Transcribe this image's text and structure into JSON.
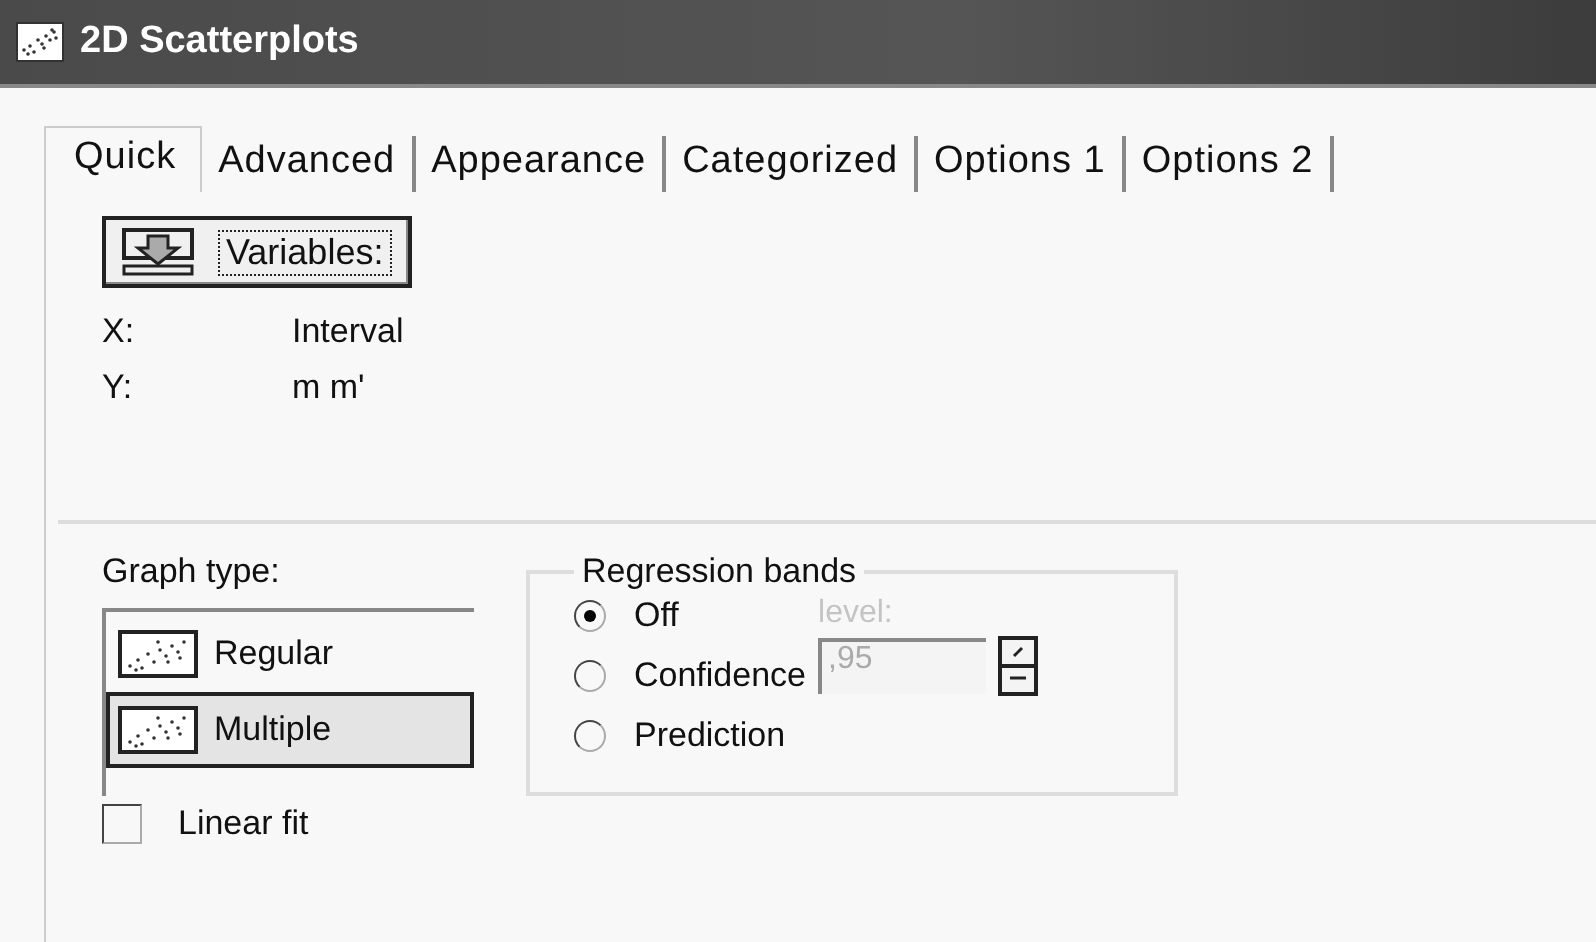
{
  "window": {
    "title": "2D Scatterplots"
  },
  "tabs": [
    {
      "label": "Quick",
      "selected": true
    },
    {
      "label": "Advanced",
      "selected": false
    },
    {
      "label": "Appearance",
      "selected": false
    },
    {
      "label": "Categorized",
      "selected": false
    },
    {
      "label": "Options 1",
      "selected": false
    },
    {
      "label": "Options 2",
      "selected": false
    }
  ],
  "variables_button": {
    "label": "Variables:"
  },
  "variables": [
    {
      "axis": "X:",
      "value": "Interval"
    },
    {
      "axis": "Y:",
      "value": "m m'"
    }
  ],
  "graph_type": {
    "label": "Graph type:",
    "items": [
      {
        "label": "Regular",
        "selected": false
      },
      {
        "label": "Multiple",
        "selected": true
      }
    ]
  },
  "regression_bands": {
    "title": "Regression bands",
    "options": [
      {
        "label": "Off",
        "selected": true
      },
      {
        "label": "Confidence",
        "selected": false
      },
      {
        "label": "Prediction",
        "selected": false
      }
    ],
    "level": {
      "label": "level:",
      "value": ",95",
      "disabled": true
    }
  },
  "linear_fit": {
    "label": "Linear fit",
    "checked": false
  }
}
